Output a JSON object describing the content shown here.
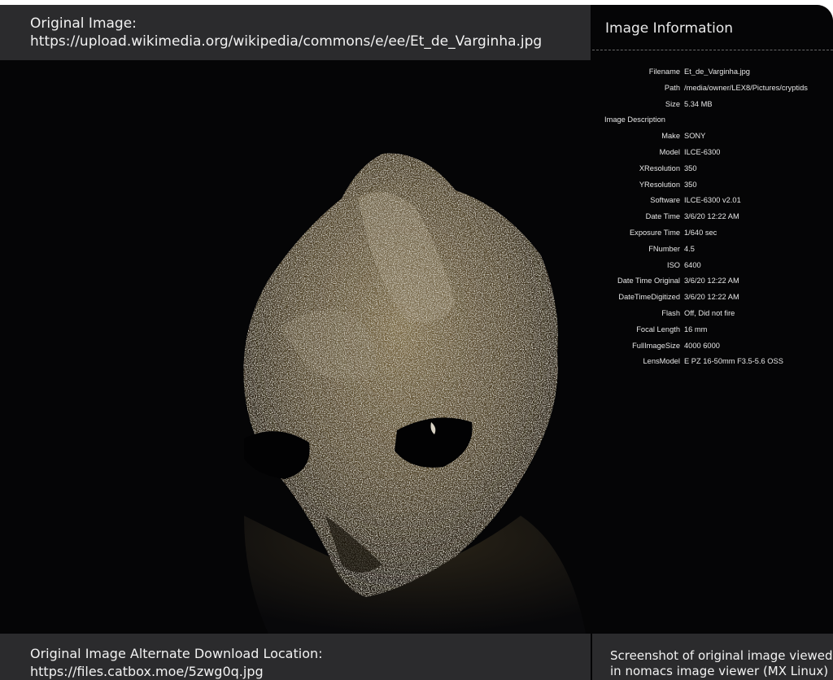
{
  "top_caption": {
    "line1": "Original Image:",
    "line2": "https://upload.wikimedia.org/wikipedia/commons/e/ee/Et_de_Varginha.jpg"
  },
  "info_panel": {
    "title": "Image Information",
    "rows": [
      {
        "key": "Filename",
        "value": "Et_de_Varginha.jpg"
      },
      {
        "key": "Path",
        "value": "/media/owner/LEX8/Pictures/cryptids"
      },
      {
        "key": "Size",
        "value": "5.34 MB"
      },
      {
        "key": "Image Description",
        "value": ""
      },
      {
        "key": "Make",
        "value": "SONY"
      },
      {
        "key": "Model",
        "value": "ILCE-6300"
      },
      {
        "key": "XResolution",
        "value": "350"
      },
      {
        "key": "YResolution",
        "value": "350"
      },
      {
        "key": "Software",
        "value": "ILCE-6300 v2.01"
      },
      {
        "key": "Date Time",
        "value": "3/6/20 12:22 AM"
      },
      {
        "key": "Exposure Time",
        "value": "1/640 sec"
      },
      {
        "key": "FNumber",
        "value": "4.5"
      },
      {
        "key": "ISO",
        "value": "6400"
      },
      {
        "key": "Date Time Original",
        "value": "3/6/20 12:22 AM"
      },
      {
        "key": "DateTimeDigitized",
        "value": "3/6/20 12:22 AM"
      },
      {
        "key": "Flash",
        "value": "Off, Did not fire"
      },
      {
        "key": "Focal Length",
        "value": "16 mm"
      },
      {
        "key": "FullImageSize",
        "value": "4000 6000"
      },
      {
        "key": "LensModel",
        "value": "E PZ 16-50mm F3.5-5.6 OSS"
      }
    ]
  },
  "bottom_left": {
    "line1": "Original Image Alternate Download Location:",
    "line2": "https://files.catbox.moe/5zwg0q.jpg"
  },
  "bottom_right": {
    "line1": "Screenshot of original image viewed",
    "line2": "in nomacs image viewer (MX Linux)"
  },
  "colors": {
    "caption_bar": "#2b2b2d",
    "background": "#040405",
    "text": "#f2f2f2"
  }
}
